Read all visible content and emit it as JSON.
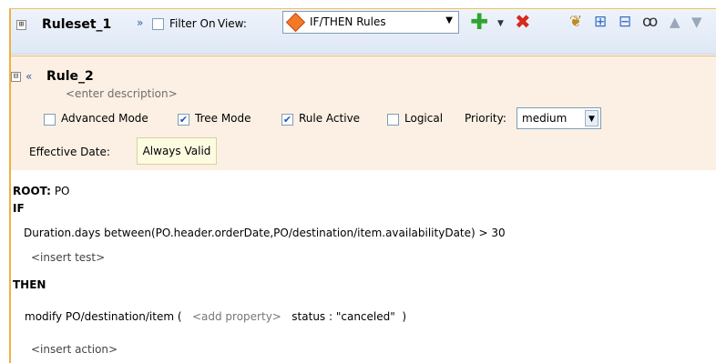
{
  "ruleset": {
    "expander": "⊞",
    "name": "Ruleset_1",
    "chevron": "»",
    "filter_checked": "",
    "filter_label": "Filter On",
    "view_label": "View:",
    "view_value": "IF/THEN Rules",
    "view_icon": "diamond-icon",
    "toolbar_icons": [
      "add-icon",
      "delete-icon",
      "tree-icon",
      "expand-all-icon",
      "collapse-all-icon",
      "glasses-icon",
      "up-icon",
      "down-icon"
    ]
  },
  "rule": {
    "expander": "⊟",
    "chevron": "«",
    "name": "Rule_2",
    "description": "<enter description>",
    "advanced_mode": {
      "label": "Advanced Mode",
      "checked": ""
    },
    "tree_mode": {
      "label": "Tree Mode",
      "checked": "✔"
    },
    "rule_active": {
      "label": "Rule Active",
      "checked": "✔"
    },
    "logical": {
      "label": "Logical",
      "checked": ""
    },
    "priority_label": "Priority:",
    "priority_value": "medium",
    "effective_date_label": "Effective Date:",
    "effective_date_value": "Always Valid"
  },
  "body": {
    "root_keyword": "ROOT:",
    "root_value": "PO",
    "if_label": "IF",
    "condition": "Duration.days between(PO.header.orderDate,PO/destination/item.availabilityDate)  >  30",
    "insert_test": "<insert test>",
    "then_label": "THEN",
    "action_prefix": "modify PO/destination/item (   ",
    "add_property": "<add property>",
    "action_suffix": "   status : \"canceled\"  )",
    "insert_action": "<insert action>"
  },
  "colors": {
    "accent_border": "#f0b040",
    "rule_panel_bg": "#fbf0e3",
    "header_bg": "#dfe8f6",
    "add_icon": "#2fa52f",
    "delete_icon": "#d62a1a",
    "view_icon": "#f07a28"
  }
}
